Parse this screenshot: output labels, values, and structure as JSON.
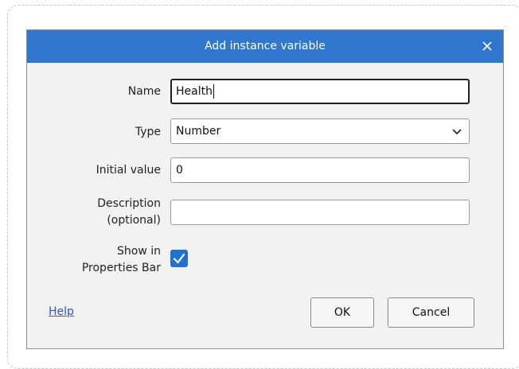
{
  "dialog": {
    "title": "Add instance variable",
    "close_icon": "close-icon",
    "fields": {
      "name": {
        "label": "Name",
        "value": "Health"
      },
      "type": {
        "label": "Type",
        "value": "Number",
        "icon": "chevron-down-icon"
      },
      "initial_value": {
        "label": "Initial value",
        "value": "0"
      },
      "description": {
        "label_line1": "Description",
        "label_line2": "(optional)",
        "value": ""
      },
      "show_in_properties_bar": {
        "label_line1": "Show in",
        "label_line2": "Properties Bar",
        "checked": true
      }
    },
    "help_link": "Help",
    "ok_label": "OK",
    "cancel_label": "Cancel",
    "colors": {
      "titlebar": "#3277cf",
      "checkbox": "#1f72d0",
      "link": "#2a55d6"
    }
  }
}
